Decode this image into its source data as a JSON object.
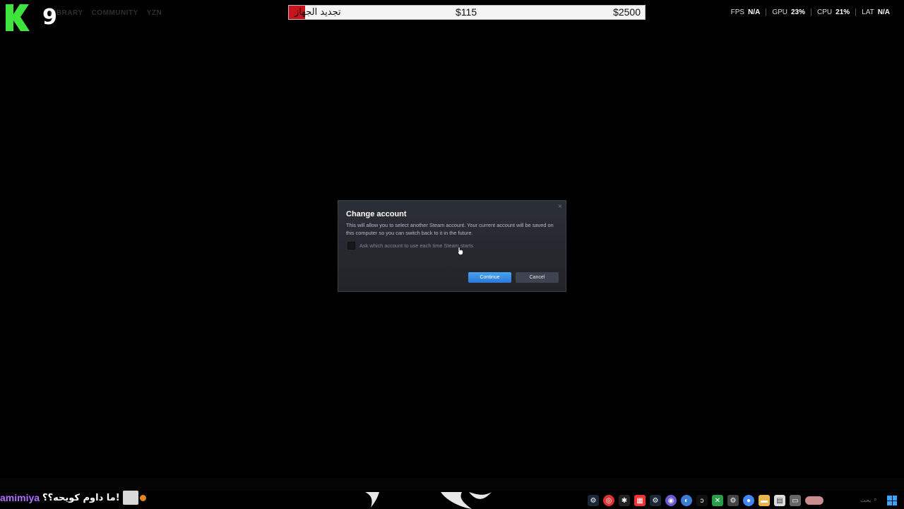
{
  "steam_nav": {
    "items": [
      "LIBRARY",
      "COMMUNITY",
      "YZN"
    ]
  },
  "overlay": {
    "logo_number": "9",
    "goal": {
      "title": "تجديد الجهاز",
      "current": "$115",
      "target": "$2500",
      "progress_fraction": 0.046
    },
    "stats": [
      {
        "label": "FPS",
        "value": "N/A"
      },
      {
        "label": "GPU",
        "value": "23%"
      },
      {
        "label": "CPU",
        "value": "21%"
      },
      {
        "label": "LAT",
        "value": "N/A"
      }
    ]
  },
  "dialog": {
    "title": "Change account",
    "body": "This will allow you to select another Steam account. Your current account will be saved on this computer so you can switch back to it in the future.",
    "checkbox_label": "Ask which account to use each time Steam starts",
    "checkbox_checked": false,
    "continue_label": "Continue",
    "cancel_label": "Cancel",
    "close_glyph": "×"
  },
  "chat": {
    "user": "amimiya",
    "message": "ما داوم كويحه؟؟!"
  },
  "taskbar": {
    "icons": [
      "steam-icon",
      "app-icon",
      "terminal-icon",
      "media-icon",
      "steam-icon-2",
      "chat-icon",
      "browser-icon",
      "edge-icon",
      "app-icon-2",
      "xbox-icon",
      "settings-icon",
      "chrome-icon",
      "folder-icon",
      "calendar-icon",
      "window-icon"
    ],
    "search_label": "بحث"
  },
  "colors": {
    "accent": "#47a3f0",
    "goal_fill": "#c8141c",
    "chat_user": "#b36dff",
    "k9_green": "#3ee33e"
  }
}
